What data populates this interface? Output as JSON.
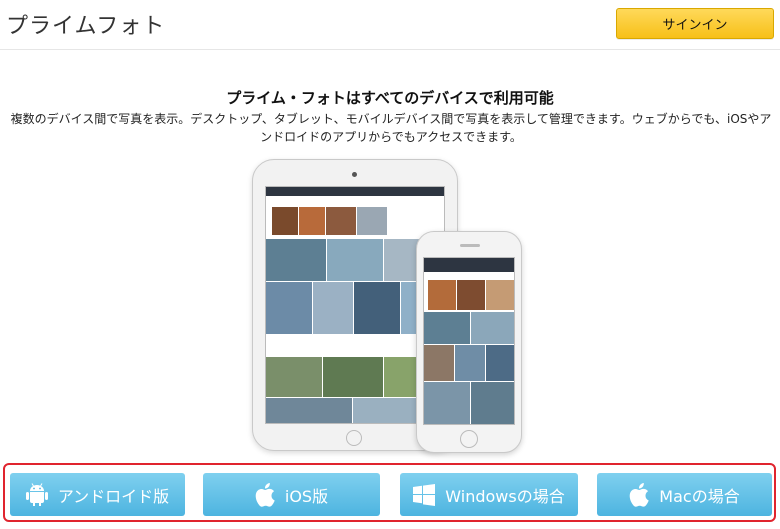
{
  "header": {
    "brand": "プライムフォト",
    "signin_label": "サインイン",
    "signin_color": "#f7c018"
  },
  "hero": {
    "headline": "プライム・フォトはすべてのデバイスで利用可能",
    "description": "複数のデバイス間で写真を表示。デスクトップ、タブレット、モバイルデバイス間で写真を表示して管理できます。ウェブからでも、iOSやアンドロイドのアプリからでもアクセスできます。"
  },
  "platforms": {
    "highlight_color": "#e0242e",
    "button_color": "#5bbde6",
    "buttons": [
      {
        "label": "アンドロイド版",
        "icon": "android-icon"
      },
      {
        "label": "iOS版",
        "icon": "apple-icon"
      },
      {
        "label": "Windowsの場合",
        "icon": "windows-icon"
      },
      {
        "label": "Macの場合",
        "icon": "apple-icon"
      }
    ]
  }
}
